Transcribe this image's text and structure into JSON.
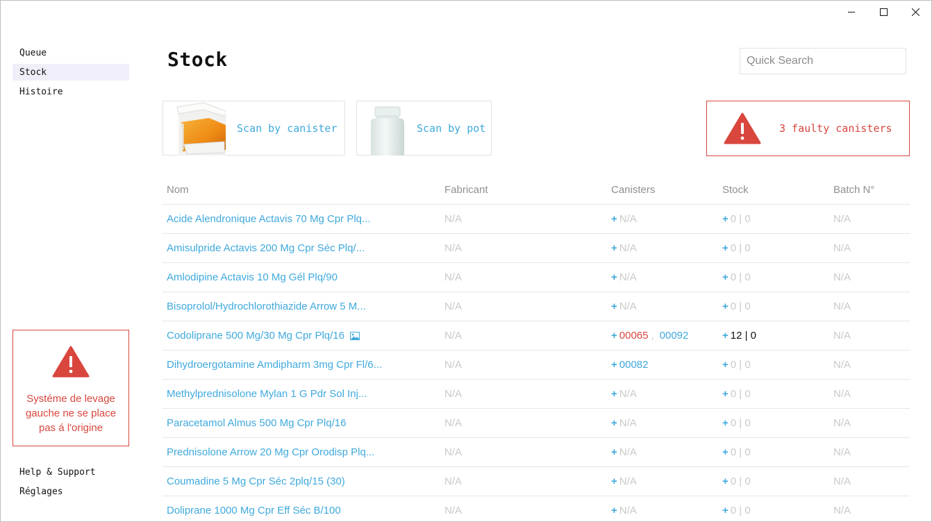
{
  "sidebar": {
    "items": [
      {
        "label": "Queue"
      },
      {
        "label": "Stock"
      },
      {
        "label": "Histoire"
      }
    ],
    "alert": {
      "text": "Systéme de levage gauche ne se place pas á l'origine"
    },
    "bottom": [
      {
        "label": "Help & Support"
      },
      {
        "label": "Réglages"
      }
    ]
  },
  "page": {
    "title": "Stock"
  },
  "search": {
    "placeholder": "Quick Search"
  },
  "actions": {
    "scan_canister": "Scan by canister",
    "scan_pot": "Scan by pot",
    "faulty": "3 faulty canisters"
  },
  "table": {
    "headers": {
      "name": "Nom",
      "fabricant": "Fabricant",
      "canisters": "Canisters",
      "stock": "Stock",
      "batch": "Batch N°"
    },
    "rows": [
      {
        "name": "Acide Alendronique Actavis 70 Mg Cpr Plq...",
        "fabricant": "N/A",
        "canisters": "N/A",
        "stock": "0 | 0",
        "batch": "N/A"
      },
      {
        "name": "Amisulpride Actavis 200 Mg Cpr Séc Plq/...",
        "fabricant": "N/A",
        "canisters": "N/A",
        "stock": "0 | 0",
        "batch": "N/A"
      },
      {
        "name": "Amlodipine Actavis 10 Mg Gél Plq/90",
        "fabricant": "N/A",
        "canisters": "N/A",
        "stock": "0 | 0",
        "batch": "N/A"
      },
      {
        "name": "Bisoprolol/Hydrochlorothiazide Arrow 5 M...",
        "fabricant": "N/A",
        "canisters": "N/A",
        "stock": "0 | 0",
        "batch": "N/A"
      },
      {
        "name": "Codoliprane 500 Mg/30 Mg Cpr Plq/16",
        "fabricant": "N/A",
        "canister_a": "00065",
        "canister_b": "00092",
        "stock": "12 | 0",
        "batch": "N/A"
      },
      {
        "name": "Dihydroergotamine Amdipharm 3mg Cpr Fl/6...",
        "fabricant": "N/A",
        "canisters": "00082",
        "stock": "0 | 0",
        "batch": "N/A"
      },
      {
        "name": "Methylprednisolone Mylan 1 G Pdr Sol Inj...",
        "fabricant": "N/A",
        "canisters": "N/A",
        "stock": "0 | 0",
        "batch": "N/A"
      },
      {
        "name": "Paracetamol Almus 500 Mg Cpr Plq/16",
        "fabricant": "N/A",
        "canisters": "N/A",
        "stock": "0 | 0",
        "batch": "N/A"
      },
      {
        "name": "Prednisolone Arrow 20 Mg Cpr Orodisp Plq...",
        "fabricant": "N/A",
        "canisters": "N/A",
        "stock": "0 | 0",
        "batch": "N/A"
      },
      {
        "name": "Coumadine 5 Mg Cpr Séc 2plq/15 (30)",
        "fabricant": "N/A",
        "canisters": "N/A",
        "stock": "0 | 0",
        "batch": "N/A"
      },
      {
        "name": "Doliprane 1000 Mg Cpr Eff Séc B/100",
        "fabricant": "N/A",
        "canisters": "N/A",
        "stock": "0 | 0",
        "batch": "N/A"
      }
    ]
  },
  "colors": {
    "accent": "#3fa9dd",
    "danger": "#d9463e",
    "muted": "#c9c9c9",
    "active_nav": "#efeef9"
  },
  "icons": {
    "warning": "warning-triangle-icon",
    "image": "image-icon",
    "minimize": "minimize-icon",
    "maximize": "maximize-icon",
    "close": "close-icon"
  }
}
